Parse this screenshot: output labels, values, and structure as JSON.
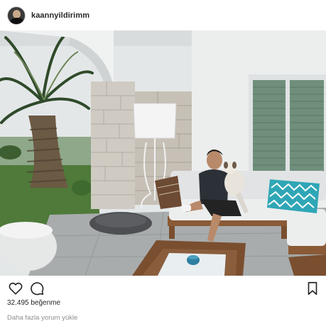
{
  "post": {
    "username": "kaannyildirimm",
    "likes_text": "32.495 beğenme",
    "load_more_comments": "Daha fazla yorum yükle"
  },
  "icons": {
    "avatar": "profile-avatar",
    "like": "heart-icon",
    "comment": "comment-icon",
    "save": "bookmark-icon"
  },
  "colors": {
    "text": "#262626",
    "muted": "#8e8e8e",
    "shutter_green": "#6f8f7c",
    "pillow_teal": "#2fa6b6"
  }
}
